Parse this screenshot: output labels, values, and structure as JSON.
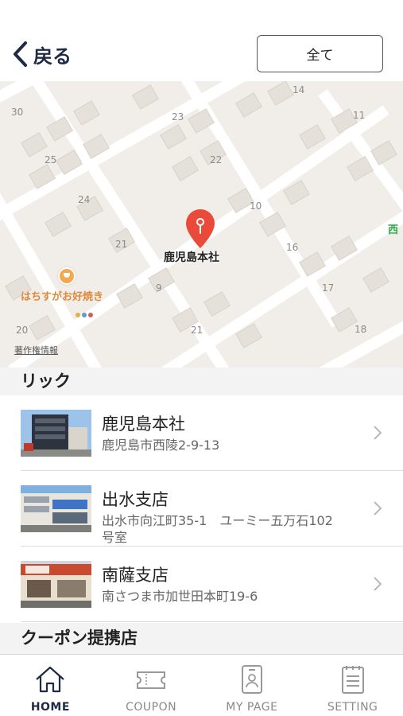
{
  "header": {
    "back_label": "戻る",
    "all_button_label": "全て"
  },
  "map": {
    "block_numbers": [
      "30",
      "23",
      "14",
      "11",
      "25",
      "22",
      "24",
      "10",
      "21",
      "16",
      "9",
      "17",
      "20",
      "21",
      "18"
    ],
    "pin_label": "鹿児島本社",
    "poi_label": "はちすがお好焼き",
    "edge_label": "西",
    "legal_link": "著作権情報"
  },
  "sections": {
    "branches_title": "リック",
    "coupon_title": "クーポン提携店"
  },
  "branches": [
    {
      "name": "鹿児島本社",
      "address": "鹿児島市西陵2-9-13"
    },
    {
      "name": "出水支店",
      "address": "出水市向江町35-1　ユーミー五万石102号室"
    },
    {
      "name": "南薩支店",
      "address": "南さつま市加世田本町19-6"
    }
  ],
  "tabbar": {
    "tabs": [
      {
        "label": "HOME",
        "icon": "home-icon",
        "active": true
      },
      {
        "label": "COUPON",
        "icon": "ticket-icon",
        "active": false
      },
      {
        "label": "MY PAGE",
        "icon": "member-card-icon",
        "active": false
      },
      {
        "label": "SETTING",
        "icon": "clipboard-icon",
        "active": false
      }
    ]
  },
  "colors": {
    "accent": "#1f2a44",
    "pin": "#ea4a3a",
    "map_background": "#f1eee9",
    "poi": "#e0893a"
  }
}
